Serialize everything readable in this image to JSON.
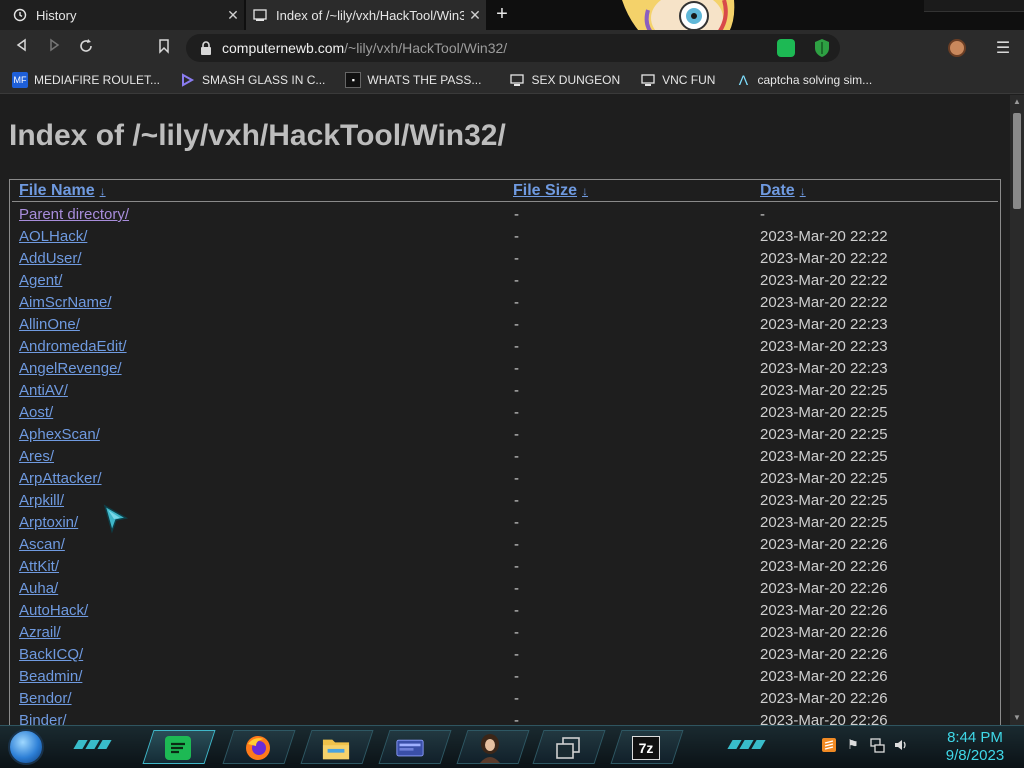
{
  "browser": {
    "tabs": [
      {
        "title": "History",
        "icon": "history-icon",
        "active": false
      },
      {
        "title": "Index of /~lily/vxh/HackTool/Win32/",
        "icon": "page-icon",
        "active": true
      }
    ],
    "url": {
      "host": "computernewb.com",
      "path": "/~lily/vxh/HackTool/Win32/"
    },
    "bookmarks": [
      {
        "label": "MEDIAFIRE ROULET...",
        "icon": "mediafire-icon"
      },
      {
        "label": "SMASH GLASS IN C...",
        "icon": "visual-studio-icon"
      },
      {
        "label": "WHATS THE PASS...",
        "icon": "dark-site-icon"
      },
      {
        "label": "SEX DUNGEON",
        "icon": "computer-icon"
      },
      {
        "label": "VNC FUN",
        "icon": "computer-icon"
      },
      {
        "label": "captcha solving sim...",
        "icon": "lambda-icon"
      }
    ]
  },
  "page": {
    "title": "Index of /~lily/vxh/HackTool/Win32/",
    "headers": {
      "name": "File Name",
      "size": "File Size",
      "date": "Date",
      "sort_arrow": "↓"
    },
    "rows": [
      {
        "name": "Parent directory/",
        "size": "-",
        "date": "-"
      },
      {
        "name": "AOLHack/",
        "size": "-",
        "date": "2023-Mar-20 22:22"
      },
      {
        "name": "AddUser/",
        "size": "-",
        "date": "2023-Mar-20 22:22"
      },
      {
        "name": "Agent/",
        "size": "-",
        "date": "2023-Mar-20 22:22"
      },
      {
        "name": "AimScrName/",
        "size": "-",
        "date": "2023-Mar-20 22:22"
      },
      {
        "name": "AllinOne/",
        "size": "-",
        "date": "2023-Mar-20 22:23"
      },
      {
        "name": "AndromedaEdit/",
        "size": "-",
        "date": "2023-Mar-20 22:23"
      },
      {
        "name": "AngelRevenge/",
        "size": "-",
        "date": "2023-Mar-20 22:23"
      },
      {
        "name": "AntiAV/",
        "size": "-",
        "date": "2023-Mar-20 22:25"
      },
      {
        "name": "Aost/",
        "size": "-",
        "date": "2023-Mar-20 22:25"
      },
      {
        "name": "AphexScan/",
        "size": "-",
        "date": "2023-Mar-20 22:25"
      },
      {
        "name": "Ares/",
        "size": "-",
        "date": "2023-Mar-20 22:25"
      },
      {
        "name": "ArpAttacker/",
        "size": "-",
        "date": "2023-Mar-20 22:25"
      },
      {
        "name": "Arpkill/",
        "size": "-",
        "date": "2023-Mar-20 22:25"
      },
      {
        "name": "Arptoxin/",
        "size": "-",
        "date": "2023-Mar-20 22:25"
      },
      {
        "name": "Ascan/",
        "size": "-",
        "date": "2023-Mar-20 22:26"
      },
      {
        "name": "AttKit/",
        "size": "-",
        "date": "2023-Mar-20 22:26"
      },
      {
        "name": "Auha/",
        "size": "-",
        "date": "2023-Mar-20 22:26"
      },
      {
        "name": "AutoHack/",
        "size": "-",
        "date": "2023-Mar-20 22:26"
      },
      {
        "name": "Azrail/",
        "size": "-",
        "date": "2023-Mar-20 22:26"
      },
      {
        "name": "BackICQ/",
        "size": "-",
        "date": "2023-Mar-20 22:26"
      },
      {
        "name": "Beadmin/",
        "size": "-",
        "date": "2023-Mar-20 22:26"
      },
      {
        "name": "Bendor/",
        "size": "-",
        "date": "2023-Mar-20 22:26"
      },
      {
        "name": "Binder/",
        "size": "-",
        "date": "2023-Mar-20 22:26"
      }
    ]
  },
  "taskbar": {
    "apps": [
      "spotify-icon",
      "firefox-icon",
      "file-explorer-icon",
      "window-app-icon",
      "portrait-icon",
      "task-view-icon",
      "7zip-icon"
    ],
    "app_7zip_text": "7z",
    "clock": {
      "time": "8:44 PM",
      "date": "9/8/2023"
    }
  },
  "colors": {
    "link": "#6f9ae0",
    "visited": "#a88ddb",
    "accent": "#3fd8e8"
  }
}
